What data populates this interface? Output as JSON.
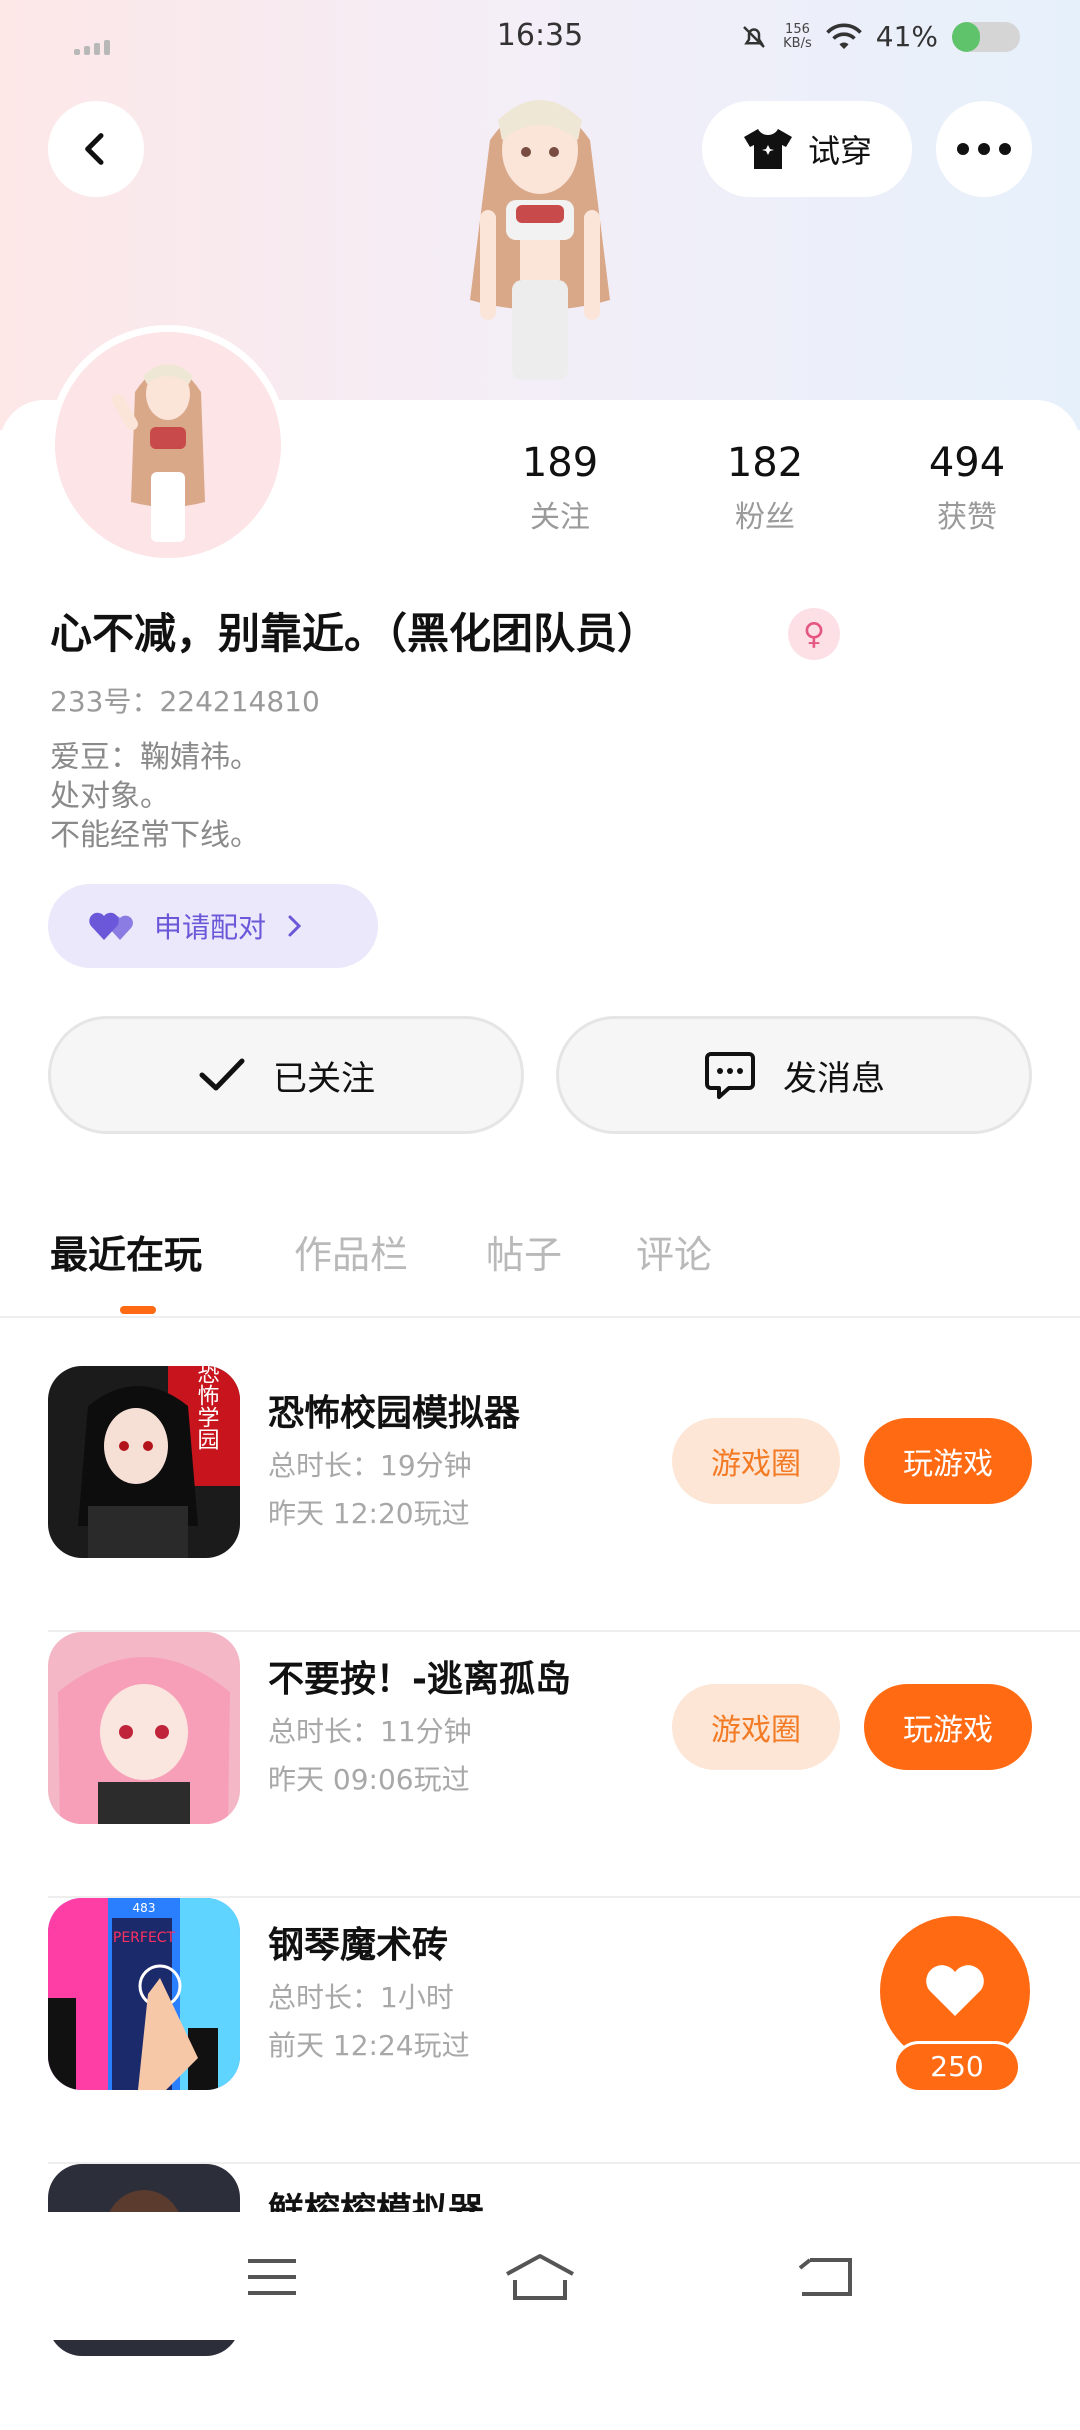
{
  "status_bar": {
    "time": "16:35",
    "net_speed_value": "156",
    "net_speed_unit": "KB/s",
    "battery": "41%",
    "battery_level": 0.41
  },
  "header": {
    "back_icon": "chevron-left-icon",
    "try_on_label": "试穿",
    "try_on_icon": "tshirt-icon",
    "more_icon": "more-dots-icon"
  },
  "profile": {
    "stats": [
      {
        "value": "189",
        "label": "关注"
      },
      {
        "value": "182",
        "label": "粉丝"
      },
      {
        "value": "494",
        "label": "获赞"
      }
    ],
    "name": "心不减，别靠近。（黑化团队员）",
    "gender_icon": "female-icon",
    "uid": "233号：224214810",
    "bio": [
      "爱豆：鞠婧祎。",
      "处对象。",
      "不能经常下线。"
    ],
    "pair_label": "申请配对",
    "followed_label": "已关注",
    "message_label": "发消息"
  },
  "tabs": [
    "最近在玩",
    "作品栏",
    "帖子",
    "评论"
  ],
  "games": [
    {
      "title": "恐怖校园模拟器",
      "duration": "总时长：19分钟",
      "last_played": "昨天 12:20玩过",
      "circle_label": "游戏圈",
      "play_label": "玩游戏",
      "icon_text": "恐怖学园"
    },
    {
      "title": "不要按！-逃离孤岛",
      "duration": "总时长：11分钟",
      "last_played": "昨天 09:06玩过",
      "circle_label": "游戏圈",
      "play_label": "玩游戏"
    },
    {
      "title": "钢琴魔术砖",
      "duration": "总时长：1小时",
      "last_played": "前天 12:24玩过",
      "icon_text": "PERFECT",
      "icon_score": "483"
    },
    {
      "title": "鲜榨榨模拟器"
    }
  ],
  "float_like": {
    "count": "250"
  },
  "colors": {
    "accent": "#ff6a13",
    "pair": "#6a58d9"
  }
}
